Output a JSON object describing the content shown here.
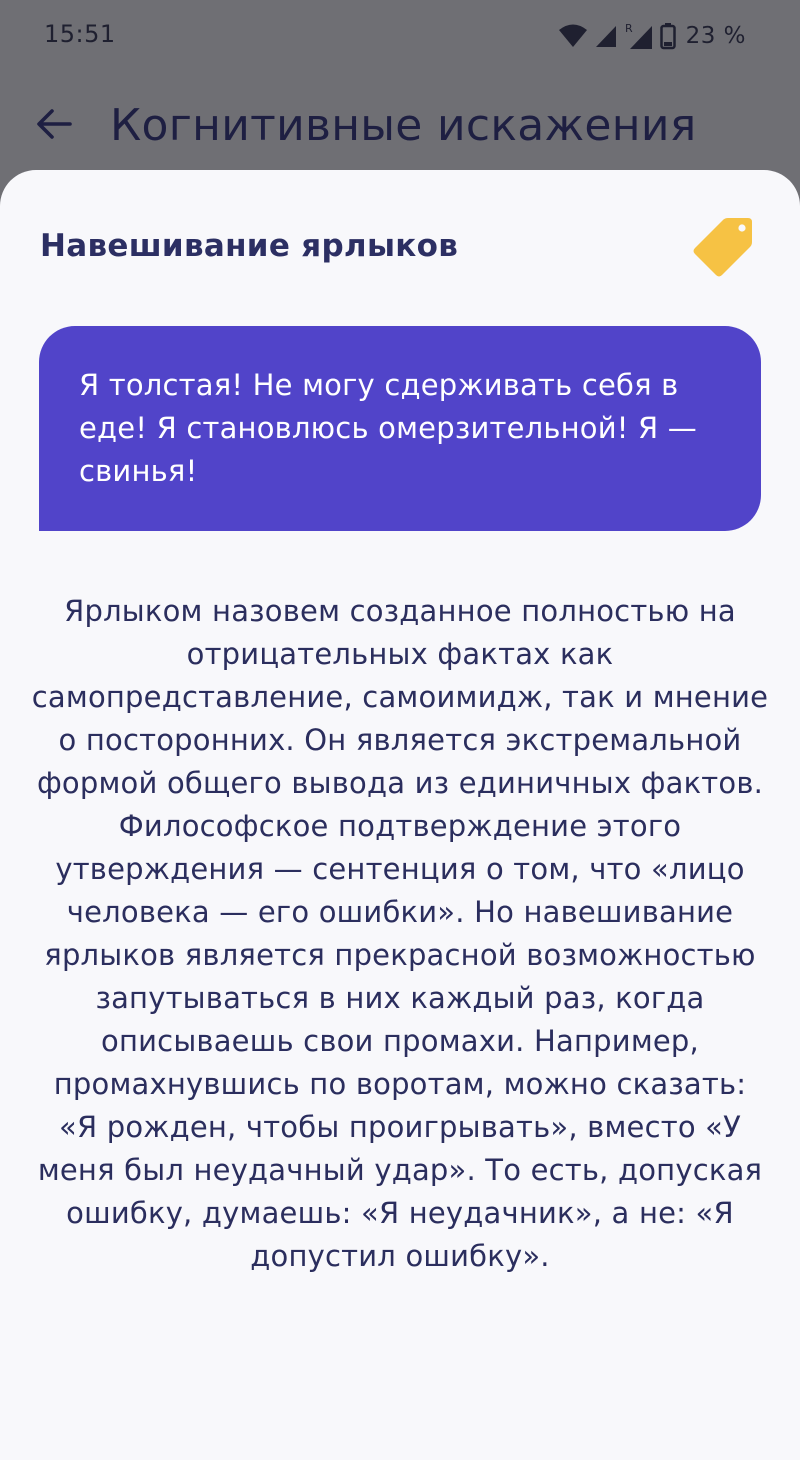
{
  "status_bar": {
    "time": "15:51",
    "battery_percent": "23 %",
    "icons": [
      "wifi-icon",
      "cell-signal-icon",
      "roaming-signal-icon",
      "battery-icon"
    ]
  },
  "app_bar": {
    "back_icon": "back-arrow-icon",
    "title": "Когнитивные искажения"
  },
  "sheet": {
    "title": "Навешивание ярлыков",
    "icon": "tag-icon",
    "quote": "Я толстая! Не могу сдерживать себя в еде! Я становлюсь омерзительной! Я — свинья!",
    "description": "Ярлыком назовем созданное полностью на отрицательных фактах как самопредставление, самоимидж, так и мнение о посторонних. Он является экстремальной формой общего вывода из единичных фактов. Философское подтверждение этого утверждения — сентенция о том, что «лицо человека — его ошибки». Но навешивание ярлыков является прекрасной возможностью запутываться в них каждый раз, когда описываешь свои промахи. Например, промахнувшись по воротам, можно сказать: «Я рожден, чтобы проигрывать», вместо «У меня был неудачный удар». То есть, допуская ошибку, думаешь: «Я неудачник», а не: «Я допустил ошибку»."
  },
  "colors": {
    "scrim": "#6f6f74",
    "sheet_background": "#f8f8fb",
    "quote_background": "#5144c9",
    "tag_accent": "#f6c244",
    "text_primary": "#2b2e5e"
  }
}
